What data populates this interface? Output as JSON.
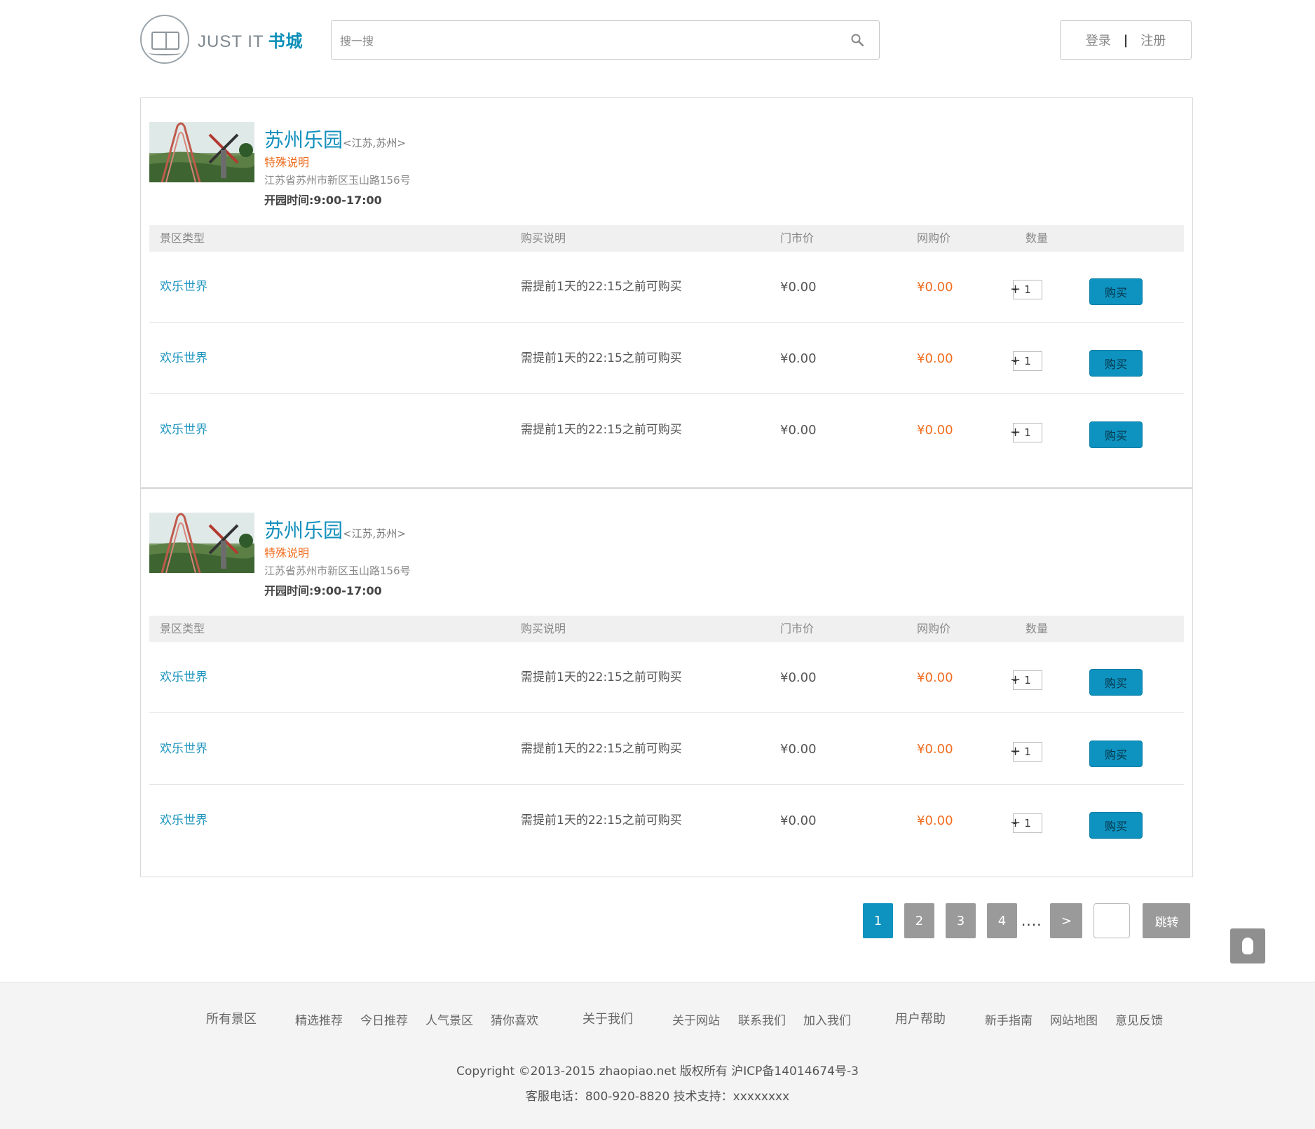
{
  "header": {
    "logo_text": "JUST IT",
    "logo_cn": "书城",
    "search_placeholder": "搜一搜",
    "login": "登录",
    "separator": "|",
    "register": "注册"
  },
  "table_headers": [
    "景区类型",
    "购买说明",
    "门市价",
    "网购价",
    "数量"
  ],
  "parks": [
    {
      "name": "苏州乐园",
      "region": "<江苏,苏州>",
      "note": "特殊说明",
      "address": "江苏省苏州市新区玉山路156号",
      "hours": "开园时间:9:00-17:00",
      "tickets": [
        {
          "type": "欢乐世界",
          "desc": "需提前1天的22:15之前可购买",
          "market_price": "¥0.00",
          "web_price": "¥0.00",
          "qty": "1",
          "buy": "购买"
        },
        {
          "type": "欢乐世界",
          "desc": "需提前1天的22:15之前可购买",
          "market_price": "¥0.00",
          "web_price": "¥0.00",
          "qty": "1",
          "buy": "购买"
        },
        {
          "type": "欢乐世界",
          "desc": "需提前1天的22:15之前可购买",
          "market_price": "¥0.00",
          "web_price": "¥0.00",
          "qty": "1",
          "buy": "购买"
        }
      ]
    },
    {
      "name": "苏州乐园",
      "region": "<江苏,苏州>",
      "note": "特殊说明",
      "address": "江苏省苏州市新区玉山路156号",
      "hours": "开园时间:9:00-17:00",
      "tickets": [
        {
          "type": "欢乐世界",
          "desc": "需提前1天的22:15之前可购买",
          "market_price": "¥0.00",
          "web_price": "¥0.00",
          "qty": "1",
          "buy": "购买"
        },
        {
          "type": "欢乐世界",
          "desc": "需提前1天的22:15之前可购买",
          "market_price": "¥0.00",
          "web_price": "¥0.00",
          "qty": "1",
          "buy": "购买"
        },
        {
          "type": "欢乐世界",
          "desc": "需提前1天的22:15之前可购买",
          "market_price": "¥0.00",
          "web_price": "¥0.00",
          "qty": "1",
          "buy": "购买"
        }
      ]
    }
  ],
  "qty_controls": {
    "minus": "-",
    "plus": "+"
  },
  "pagination": {
    "pages": [
      "1",
      "2",
      "3",
      "4"
    ],
    "active": "1",
    "ellipsis": "....",
    "next": ">",
    "jump": "跳转"
  },
  "footer": {
    "groups": [
      {
        "title": "所有景区",
        "links": [
          "精选推荐",
          "今日推荐",
          "人气景区",
          "猜你喜欢"
        ]
      },
      {
        "title": "关于我们",
        "links": [
          "关于网站",
          "联系我们",
          "加入我们"
        ]
      },
      {
        "title": "用户帮助",
        "links": [
          "新手指南",
          "网站地图",
          "意见反馈"
        ]
      }
    ],
    "copyright": "Copyright ©2013-2015 zhaopiao.net 版权所有 沪ICP备14014674号-3",
    "contact": "客服电话：800-920-8820 技术支持：xxxxxxxx"
  },
  "colors": {
    "accent": "#0e93c0",
    "price_orange": "#f06d20",
    "link_blue": "#1f95bd",
    "pager_gray": "#9a9a9a",
    "footer_bg": "#f4f4f4"
  }
}
